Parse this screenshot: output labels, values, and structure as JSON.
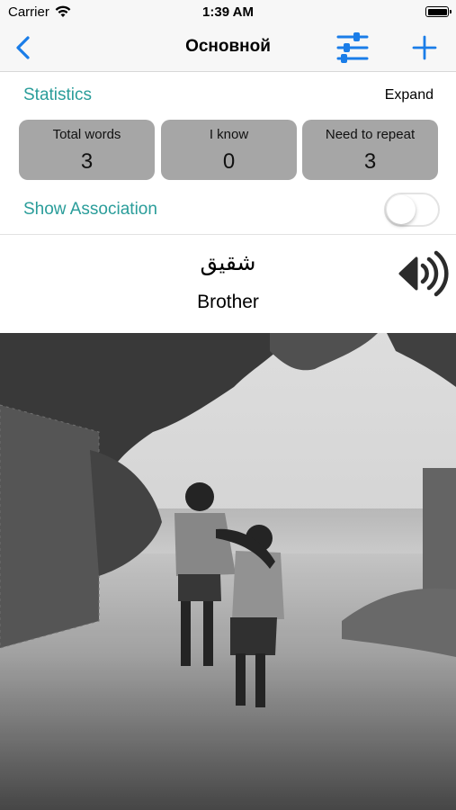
{
  "status_bar": {
    "carrier": "Carrier",
    "time": "1:39 AM"
  },
  "nav": {
    "title": "Основной"
  },
  "statistics": {
    "title": "Statistics",
    "expand_label": "Expand",
    "boxes": [
      {
        "label": "Total words",
        "value": "3"
      },
      {
        "label": "I know",
        "value": "0"
      },
      {
        "label": "Need to repeat",
        "value": "3"
      }
    ]
  },
  "association": {
    "label": "Show Association",
    "enabled": false
  },
  "word": {
    "text": "شقيق",
    "translation": "Brother"
  },
  "icons": {
    "back": "chevron-left-icon",
    "filter": "sliders-icon",
    "add": "plus-icon",
    "speaker": "speaker-icon"
  },
  "colors": {
    "accent": "#1a7de8",
    "teal": "#2a9d9a",
    "stat_box": "#a6a6a6"
  }
}
